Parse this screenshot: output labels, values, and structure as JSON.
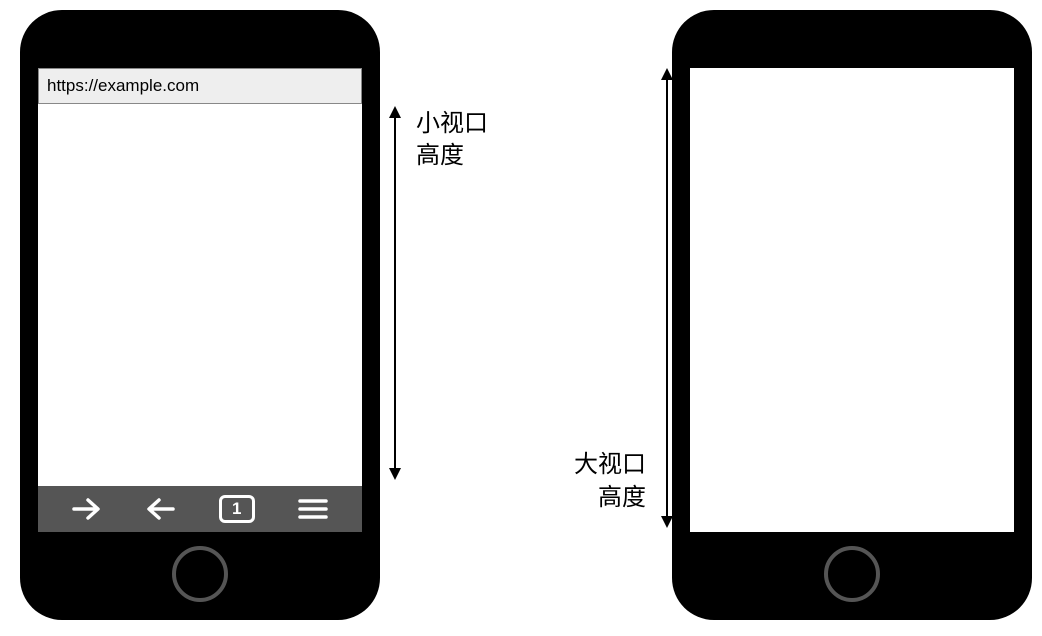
{
  "left_phone": {
    "url": "https://example.com",
    "tab_count": "1"
  },
  "right_phone": {},
  "labels": {
    "small_viewport_line1": "小视口",
    "small_viewport_line2": "高度",
    "large_viewport_line1": "大视口",
    "large_viewport_line2": "高度"
  },
  "icons": {
    "forward": "forward-arrow",
    "back": "back-arrow",
    "tabs": "tabs-badge",
    "menu": "hamburger-menu"
  }
}
